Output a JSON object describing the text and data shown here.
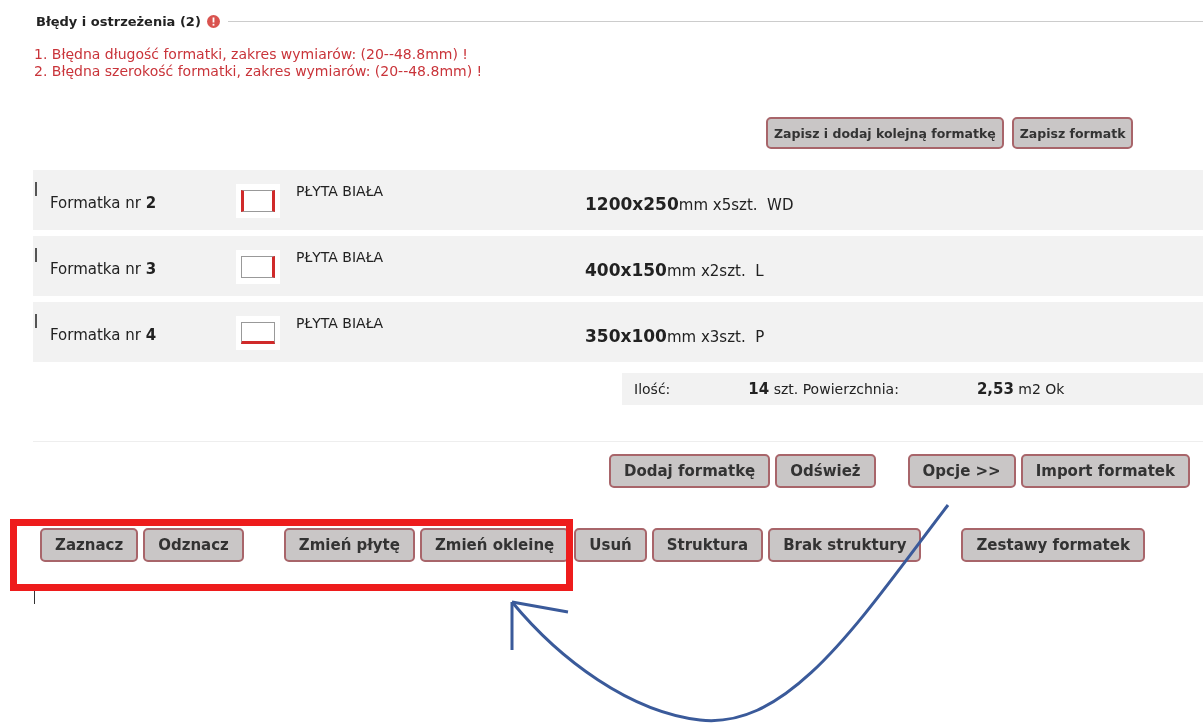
{
  "errors_section": {
    "title": "Błędy i ostrzeżenia (2)",
    "messages": [
      "1. Błędna długość formatki, zakres wymiarów: (20--48.8mm) !",
      "2. Błędna szerokość formatki, zakres wymiarów: (20--48.8mm) !"
    ]
  },
  "save_buttons": [
    "Zapisz i dodaj kolejną formatkę",
    "Zapisz formatk"
  ],
  "panels": [
    {
      "label": "Formatka nr",
      "number": "2",
      "material": "PŁYTA BIAŁA",
      "dimensions": "1200x250",
      "unit": "mm",
      "quantity": "x5szt.",
      "edge_code": "WD",
      "edges": {
        "top": false,
        "right": true,
        "bottom": false,
        "left": true
      }
    },
    {
      "label": "Formatka nr",
      "number": "3",
      "material": "PŁYTA BIAŁA",
      "dimensions": "400x150",
      "unit": "mm",
      "quantity": "x2szt.",
      "edge_code": "L",
      "edges": {
        "top": false,
        "right": true,
        "bottom": false,
        "left": false
      }
    },
    {
      "label": "Formatka nr",
      "number": "4",
      "material": "PŁYTA BIAŁA",
      "dimensions": "350x100",
      "unit": "mm",
      "quantity": "x3szt.",
      "edge_code": "P",
      "edges": {
        "top": false,
        "right": false,
        "bottom": true,
        "left": false
      }
    }
  ],
  "summary": {
    "count_label": "Ilość:",
    "count": "14",
    "count_unit": "szt.",
    "area_label": "Powierzchnia:",
    "area": "2,53",
    "area_unit": "m2",
    "cut_text": "Ok"
  },
  "action_buttons": [
    "Dodaj formatkę",
    "Odśwież",
    "Opcje >>",
    "Import formatek"
  ],
  "selection_buttons": [
    "Zaznacz",
    "Odznacz",
    "Zmień płytę",
    "Zmień okleinę",
    "Usuń",
    "Struktura",
    "Brak struktury",
    "Zestawy formatek"
  ]
}
